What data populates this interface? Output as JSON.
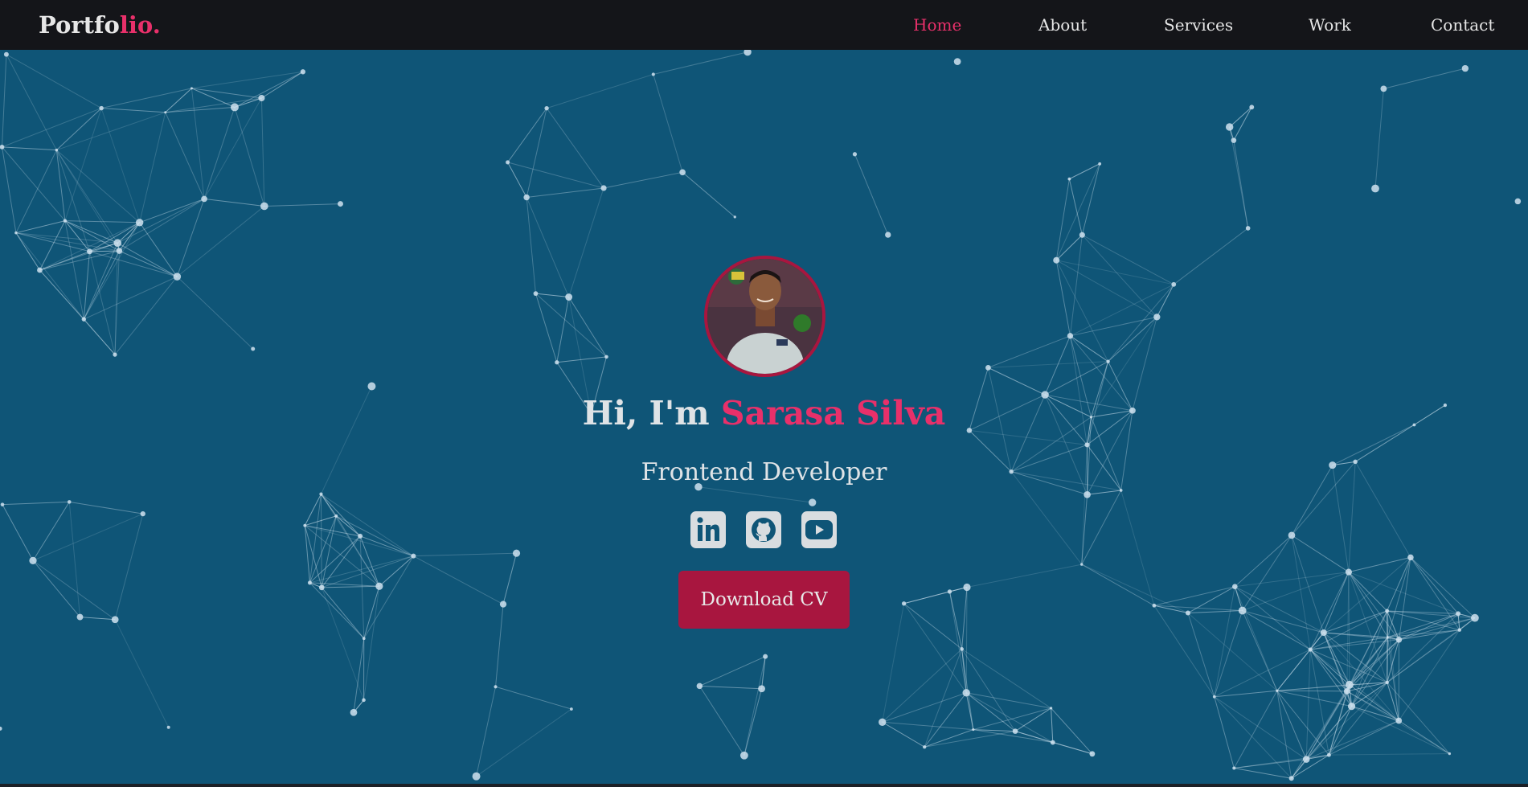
{
  "logo": {
    "main": "Portfo",
    "accent": "lio."
  },
  "nav": [
    {
      "label": "Home",
      "active": true
    },
    {
      "label": "About",
      "active": false
    },
    {
      "label": "Services",
      "active": false
    },
    {
      "label": "Work",
      "active": false
    },
    {
      "label": "Contact",
      "active": false
    }
  ],
  "hero": {
    "greeting_prefix": "Hi, I'm",
    "name": "Sarasa Silva",
    "role": "Frontend Developer",
    "cta_label": "Download CV"
  },
  "socials": [
    {
      "icon": "linkedin-icon"
    },
    {
      "icon": "github-icon"
    },
    {
      "icon": "youtube-icon"
    }
  ],
  "colors": {
    "background": "#0f5577",
    "navbar": "#141519",
    "accent": "#e8306a",
    "button": "#a8163f",
    "network_lines": "#cfe2ee"
  }
}
